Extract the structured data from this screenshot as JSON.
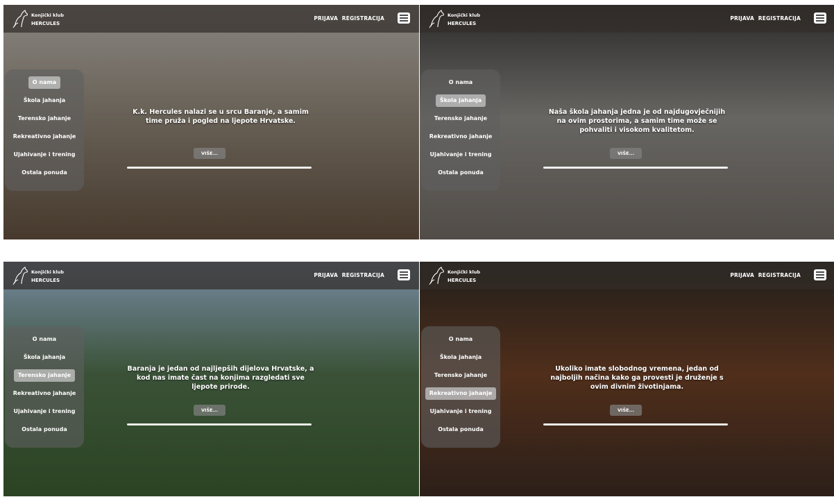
{
  "brand": {
    "line1": "Konjički klub",
    "line2": "HERCULES"
  },
  "nav": {
    "login": "PRIJAVA",
    "register": "REGISTRACIJA"
  },
  "menu_items": [
    "O nama",
    "Škola jahanja",
    "Terensko jahanje",
    "Rekreativno jahanje",
    "Ujahivanje i trening",
    "Ostala ponuda"
  ],
  "more_label": "VIŠE...",
  "slides": [
    {
      "active_index": 0,
      "caption": "K.k. Hercules nalazi se u srcu Baranje, a samim time pruža i pogled na ljepote Hrvatske.",
      "progress": 1.0,
      "theme": {
        "top": "#b7b3ac",
        "mid": "#8a8072",
        "bottom": "#5f4d3c"
      }
    },
    {
      "active_index": 1,
      "caption": "Naša škola jahanja jedna je od najdugovječnijih na ovim prostorima, a samim time može se pohvaliti i visokom kvalitetom.",
      "progress": 1.0,
      "theme": {
        "top": "#3a3836",
        "mid": "#8a8884",
        "bottom": "#6d6660"
      }
    },
    {
      "active_index": 2,
      "caption": "Baranja je jedan od najljepših dijelova Hrvatske, a kod nas imate čast na konjima razgledati sve ljepote prirode.",
      "progress": 1.0,
      "theme": {
        "top": "#9fb9d8",
        "mid": "#4e6d4a",
        "bottom": "#3a5a2e"
      }
    },
    {
      "active_index": 3,
      "caption": "Ukoliko imate slobodnog vremena, jedan od najboljih načina kako ga provesti je druženje s ovim divnim životinjama.",
      "progress": 1.0,
      "theme": {
        "top": "#2e2a24",
        "mid": "#6b3e24",
        "bottom": "#3b2a22"
      }
    }
  ]
}
